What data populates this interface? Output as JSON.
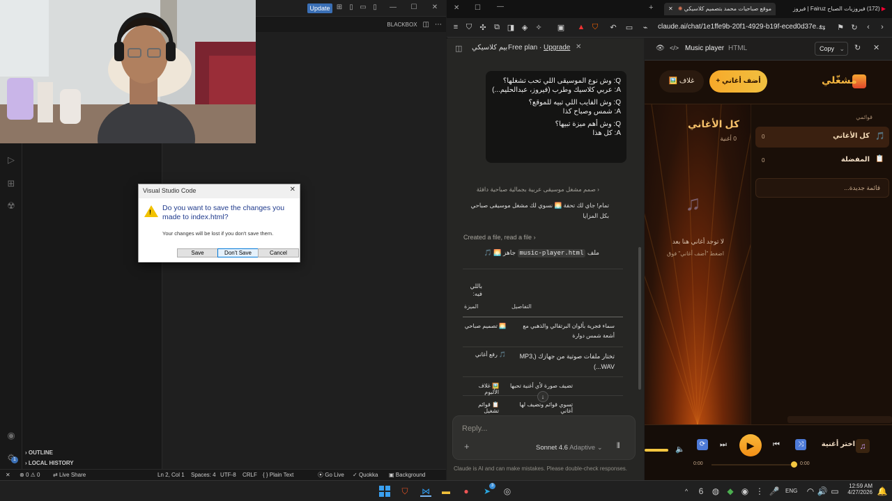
{
  "vscode": {
    "update_label": "Update",
    "blackbox_label": "BLACKBOX",
    "sidebar": {
      "outline": "OUTLINE",
      "local_history": "LOCAL HISTORY"
    },
    "status": {
      "errors": "0",
      "warnings": "0",
      "live_share": "Live Share",
      "cursor": "Ln 2, Col 1",
      "spaces": "Spaces: 4",
      "encoding": "UTF-8",
      "eol": "CRLF",
      "language": "Plain Text",
      "go_live": "Go Live",
      "quokka": "Quokka",
      "background": "Background"
    },
    "notification_badge": "1"
  },
  "dialog": {
    "title": "Visual Studio Code",
    "message": "Do you want to save the changes you made to index.html?",
    "detail": "Your changes will be lost if you don't save them.",
    "save": "Save",
    "dont_save": "Don't Save",
    "cancel": "Cancel"
  },
  "browser": {
    "tabs": [
      {
        "label": "موقع صباحيات محمد بتصميم كلاسيكي"
      },
      {
        "label": "(172) فيروزيات الصباح Fairuz | فيروز"
      }
    ],
    "url": "claude.ai/chat/1e1ffe9b-20f1-4929-b19f-eced0d37e..."
  },
  "chat": {
    "title": "بيم كلاسيكي",
    "plan": "Free plan",
    "upgrade": "Upgrade",
    "user_message": [
      {
        "q": "Q: وش نوع الموسيقى اللي تحب تشغلها؟",
        "a": "A: عربي كلاسيك وطرب (فيروز، عبدالحليم...)"
      },
      {
        "q": "Q: وش الفايب اللي تبيه للموقع؟",
        "a": "A: شمس وصباح كذا"
      },
      {
        "q": "Q: وش أهم ميزة تبيها؟",
        "a": "A: كل هذا"
      }
    ],
    "step_label": "صمم مشغل موسيقى عربية بجمالية صباحية دافئة",
    "reply_intro": "تمام! جاي لك تحفة 🌅 نسوي لك مشغل موسيقى صباحي بكل المزايا",
    "file_step": "Created a file, read a file",
    "file_ready_prefix": "ملف",
    "file_name": "music-player.html",
    "file_ready_suffix": "جاهز 🌅 🎵",
    "features_heading": "باللي فيه:",
    "table_headers": {
      "feature": "الميزة",
      "details": "التفاصيل"
    },
    "table_rows": [
      {
        "feature": "🌅 تصميم صباحي",
        "details": "سماء فجرية بألوان البرتقالي والذهبي مع أشعة شمس دوارة"
      },
      {
        "feature": "🎵 رفع أغاني",
        "details": "تختار ملفات صوتية من جهازك (MP3, WAV...)"
      },
      {
        "feature": "🖼️ غلاف الألبوم",
        "details": "تضيف صورة لأي أغنية تحبها"
      },
      {
        "feature": "📋 قوائم تشغيل",
        "details": "تسوي قوائم وتضيف لها أغاني"
      }
    ],
    "reply_placeholder": "Reply...",
    "model": "Sonnet 4.6",
    "mode": "Adaptive",
    "disclaimer": "Claude is AI and can make mistakes. Please double-check responses."
  },
  "artifact": {
    "title": "Music player",
    "type": "HTML",
    "copy": "Copy",
    "app_name": "مشغّلي",
    "add_songs": "+ أضف أغاني",
    "cover": "🖼️ غلاف",
    "lists_label": "قوائمي",
    "playlists": [
      {
        "name": "كل الأغاني",
        "count": "0",
        "icon": "🎵"
      },
      {
        "name": "المفضلة",
        "count": "0",
        "icon": "📋"
      }
    ],
    "new_list_placeholder": "قائمة جديدة...",
    "main_title": "كل الأغاني",
    "main_count": "0 أغنية",
    "empty_title": "لا توجد أغاني هنا بعد",
    "empty_hint": "اضغط \"أضف أغاني\" فوق",
    "now_playing": "اختر أغنية",
    "time_current": "0:00",
    "time_total": "0:00",
    "progress": 0,
    "volume": 1.0
  },
  "taskbar": {
    "language": "ENG",
    "time": "12:59 AM",
    "date": "4/27/2026",
    "telegram_badge": "3"
  }
}
